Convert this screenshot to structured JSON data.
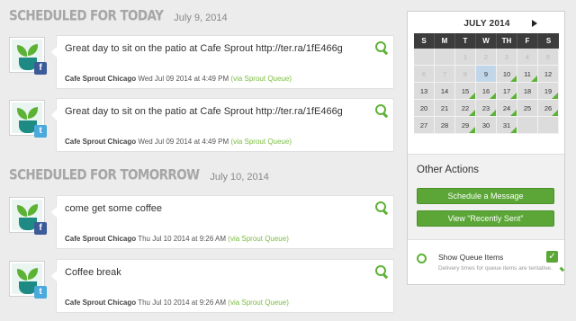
{
  "sections": [
    {
      "title": "SCHEDULED FOR TODAY",
      "date": "July 9, 2014",
      "posts": [
        {
          "network": "facebook",
          "net_glyph": "f",
          "message": "Great day to sit on the patio at Cafe Sprout http://ter.ra/1fE466g",
          "author": "Cafe Sprout Chicago",
          "time": "Wed Jul 09 2014 at 4:49 PM",
          "via": "(via Sprout Queue)"
        },
        {
          "network": "twitter",
          "net_glyph": "t",
          "message": "Great day to sit on the patio at Cafe Sprout http://ter.ra/1fE466g",
          "author": "Cafe Sprout Chicago",
          "time": "Wed Jul 09 2014 at 4:49 PM",
          "via": "(via Sprout Queue)"
        }
      ]
    },
    {
      "title": "SCHEDULED FOR TOMORROW",
      "date": "July 10, 2014",
      "posts": [
        {
          "network": "facebook",
          "net_glyph": "f",
          "message": "come get some coffee",
          "author": "Cafe Sprout Chicago",
          "time": "Thu Jul 10 2014 at 9:26 AM",
          "via": "(via Sprout Queue)"
        },
        {
          "network": "twitter",
          "net_glyph": "t",
          "message": "Coffee break",
          "author": "Cafe Sprout Chicago",
          "time": "Thu Jul 10 2014 at 9:26 AM",
          "via": "(via Sprout Queue)"
        }
      ]
    }
  ],
  "calendar": {
    "title": "JULY 2014",
    "days_of_week": [
      "S",
      "M",
      "T",
      "W",
      "TH",
      "F",
      "S"
    ],
    "weeks": [
      [
        "",
        "",
        "1",
        "2",
        "3",
        "4",
        "5"
      ],
      [
        "6",
        "7",
        "8",
        "9",
        "10",
        "11",
        "12"
      ],
      [
        "13",
        "14",
        "15",
        "16",
        "17",
        "18",
        "19"
      ],
      [
        "20",
        "21",
        "22",
        "23",
        "24",
        "25",
        "26"
      ],
      [
        "27",
        "28",
        "29",
        "30",
        "31",
        "",
        ""
      ]
    ],
    "today": "9",
    "scheduled_days": [
      "10",
      "11",
      "15",
      "16",
      "17",
      "19",
      "22",
      "23",
      "24",
      "26",
      "29",
      "31"
    ]
  },
  "other_actions": {
    "title": "Other Actions",
    "schedule_button": "Schedule a Message",
    "recent_button": "View “Recently Sent”"
  },
  "queue_items": {
    "label": "Show Queue Items",
    "checked": true,
    "note": "Delivery times for queue items are tentative."
  },
  "colors": {
    "accent_green": "#5ba637",
    "facebook": "#3b5b99",
    "twitter": "#4aa9dd",
    "today_highlight": "#c2d6ea"
  }
}
